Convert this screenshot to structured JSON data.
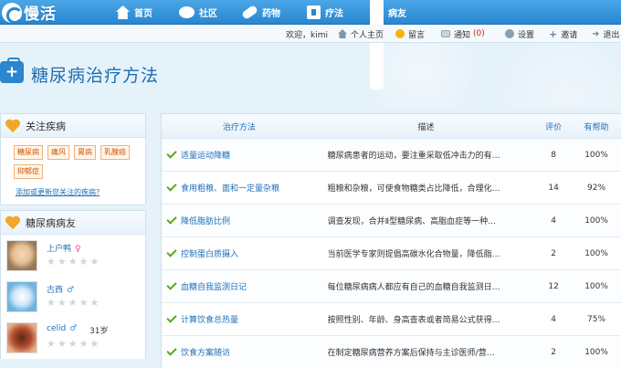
{
  "brand": {
    "logo_text": "慢活"
  },
  "nav": [
    {
      "label": "首页",
      "icon": "home-icon"
    },
    {
      "label": "社区",
      "icon": "chat-icon"
    },
    {
      "label": "药物",
      "icon": "pill-icon"
    },
    {
      "label": "疗法",
      "icon": "medkit-icon"
    },
    {
      "label": "病友",
      "icon": "friends-icon"
    }
  ],
  "userbar": {
    "welcome": "欢迎，kimi",
    "home": "个人主页",
    "message": "留言",
    "notify": "通知",
    "notify_count": "(0)",
    "settings": "设置",
    "invite": "邀请",
    "logout": "退出"
  },
  "page": {
    "title": "糖尿病治疗方法"
  },
  "sidebar": {
    "follow_title": "关注疾病",
    "tags": [
      "糖尿病",
      "痛风",
      "胃病",
      "乳腺癌",
      "抑郁症"
    ],
    "add_link": "添加或更新您关注的疾病?",
    "friends_title": "糖尿病病友",
    "friends": [
      {
        "name": "上户鸭",
        "gender": "♀",
        "age": ""
      },
      {
        "name": "古西",
        "gender": "♂",
        "age": ""
      },
      {
        "name": "celid",
        "gender": "♂",
        "age": "31岁"
      }
    ]
  },
  "table": {
    "headers": {
      "method": "治疗方法",
      "desc": "描述",
      "rate": "评价",
      "help": "有帮助"
    },
    "rows": [
      {
        "method": "适量运动降糖",
        "desc": "糖尿病患者的运动，要注重采取低冲击力的有…",
        "rate": "8",
        "help": "100%"
      },
      {
        "method": "食用粗粮、面和一定量杂粮",
        "desc": "粗粮和杂粮，可使食物糖类占比降低，合理化…",
        "rate": "14",
        "help": "92%"
      },
      {
        "method": "降低脂肪比例",
        "desc": "调查发现，合并Ⅱ型糖尿病、高脂血症等一种…",
        "rate": "4",
        "help": "100%"
      },
      {
        "method": "控制蛋白质摄入",
        "desc": "当前医学专家则提倡高碳水化合物量，降低脂…",
        "rate": "2",
        "help": "100%"
      },
      {
        "method": "血糖自我监测日记",
        "desc": "每位糖尿病病人都应有自己的血糖自我监测日…",
        "rate": "12",
        "help": "100%"
      },
      {
        "method": "计算饮食总热量",
        "desc": "按照性别、年龄、身高查表或者简易公式获得…",
        "rate": "4",
        "help": "75%"
      },
      {
        "method": "饮食方案随访",
        "desc": "在制定糖尿病营养方案后保持与主诊医师/营…",
        "rate": "2",
        "help": "100%"
      }
    ]
  }
}
